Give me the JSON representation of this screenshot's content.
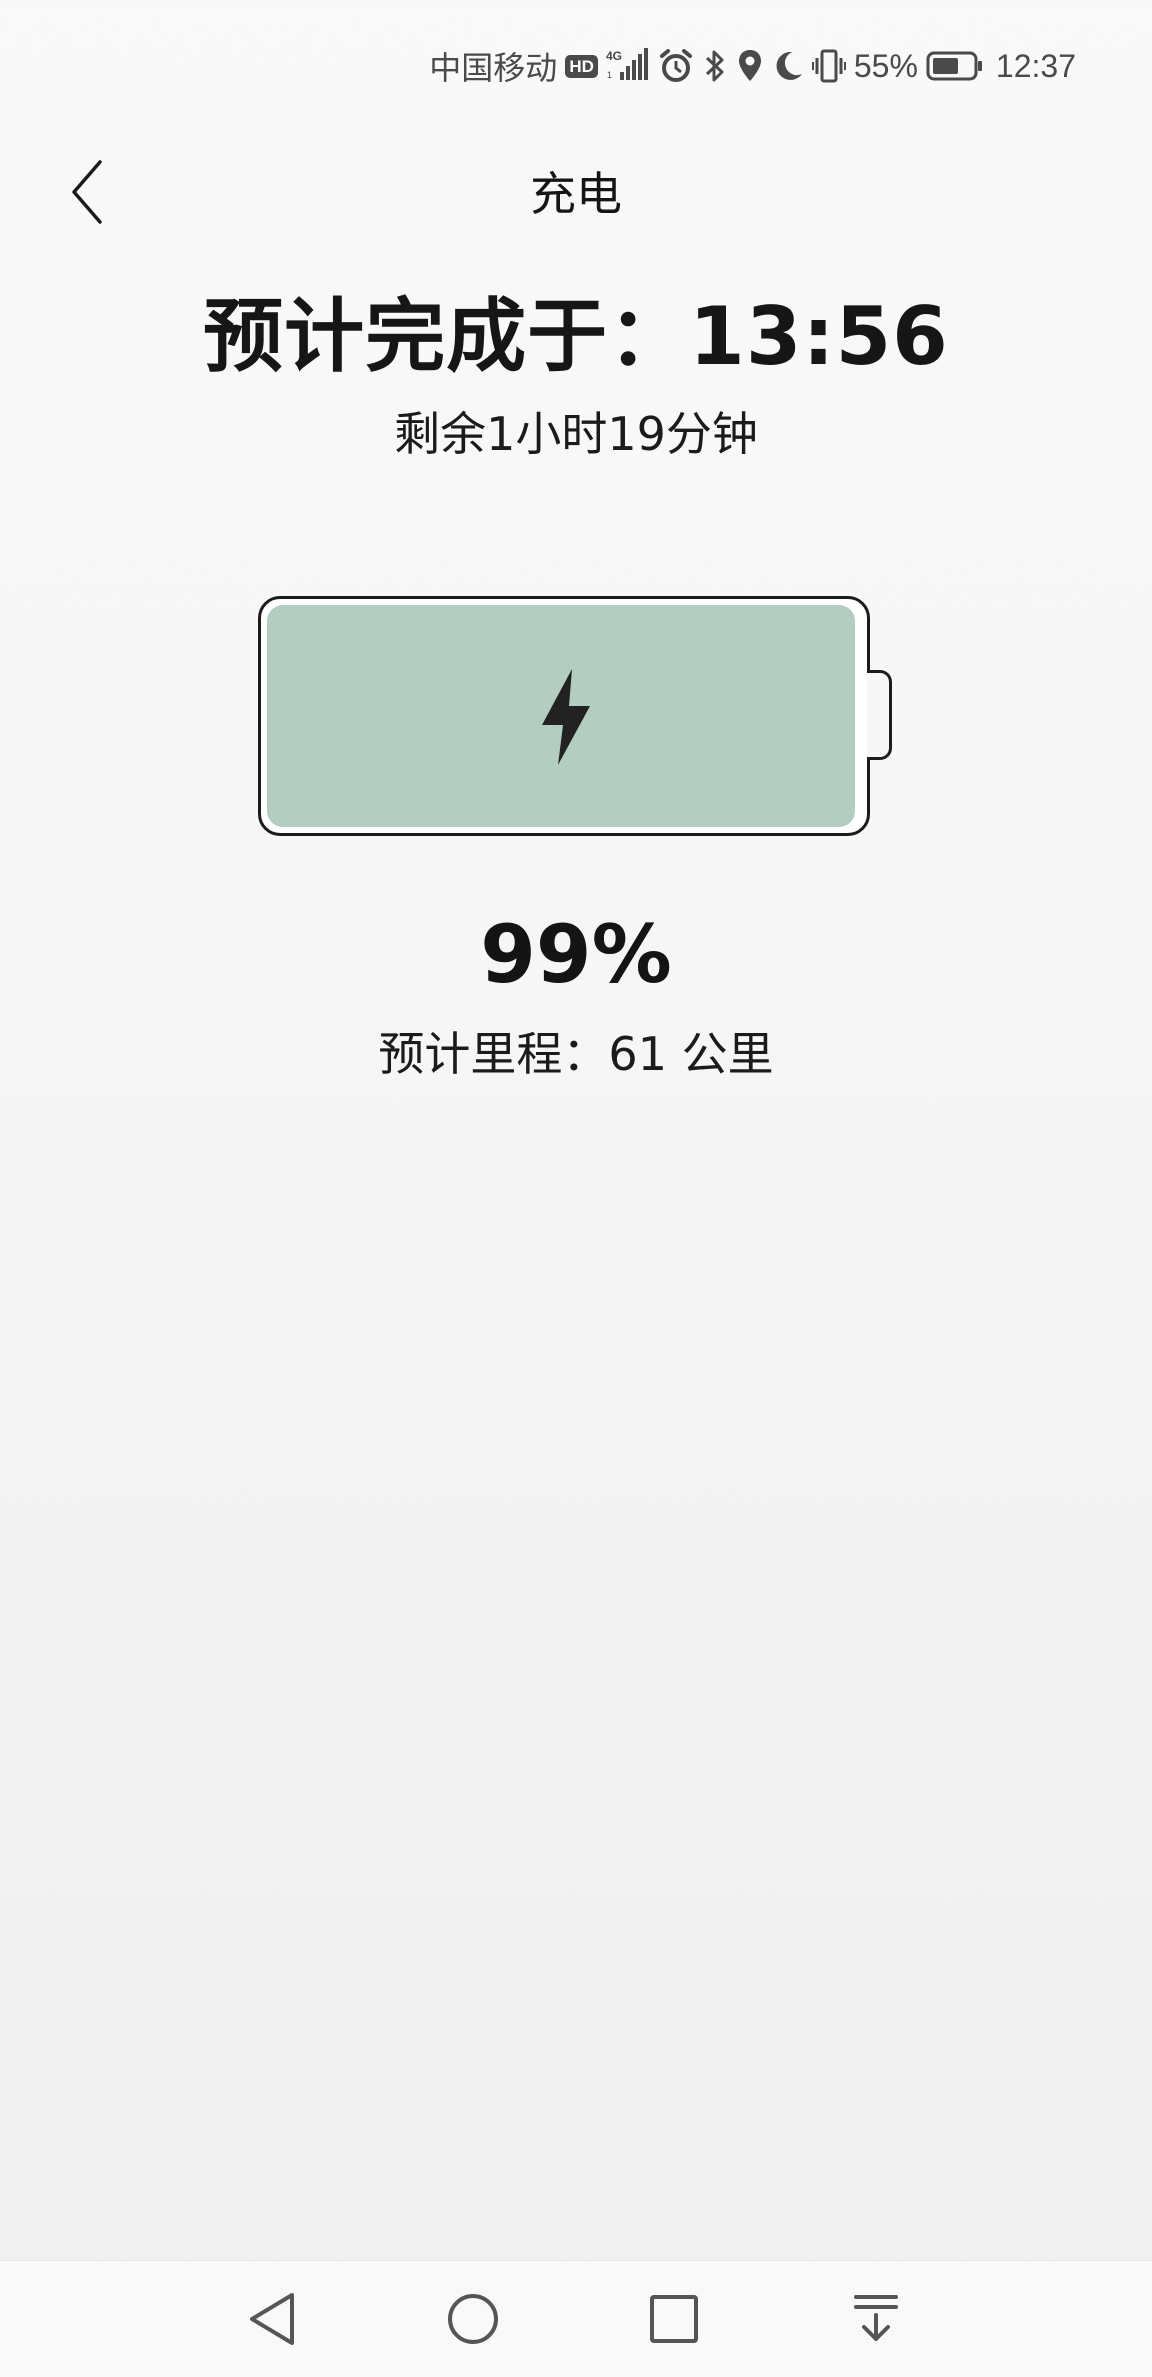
{
  "status_bar": {
    "carrier": "中国移动",
    "hd_badge": "HD",
    "network": "4G",
    "battery_level": "55%",
    "time": "12:37",
    "icons": [
      "hd-icon",
      "signal-4g-icon",
      "alarm-icon",
      "bluetooth-icon",
      "location-icon",
      "moon-icon",
      "vibrate-icon",
      "battery-icon"
    ]
  },
  "header": {
    "title": "充电",
    "back_icon": "chevron-left-icon"
  },
  "charging": {
    "eta_title": "预计完成于：13:56",
    "remaining": "剩余1小时19分钟",
    "percent_label": "99%",
    "level": 0.99,
    "range_text": "预计里程：61 公里",
    "fill_color": "#b3cdc0",
    "icon": "lightning-bolt-icon"
  },
  "nav_bar": {
    "buttons": [
      "nav-back-icon",
      "nav-home-icon",
      "nav-recents-icon",
      "nav-notification-icon"
    ]
  }
}
